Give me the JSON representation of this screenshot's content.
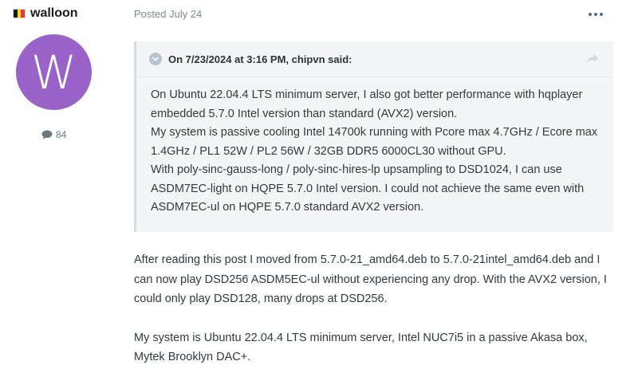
{
  "author": {
    "name": "walloon",
    "avatar_letter": "W",
    "avatar_color": "#9a63c9",
    "post_count": "84",
    "flag_colors": [
      "#1a1a1a",
      "#fdda24",
      "#ef3340"
    ]
  },
  "post": {
    "posted_label": "Posted July 24",
    "quote": {
      "header": "On 7/23/2024 at 3:16 PM, chipvn said:",
      "paragraphs": [
        "On Ubuntu 22.04.4 LTS minimum server, I also got better performance with hqplayer embedded 5.7.0 Intel version than standard (AVX2) version.",
        "My system is passive cooling Intel 14700k running with Pcore max 4.7GHz / Ecore max 1.4GHz / PL1 52W / PL2 56W / 32GB DDR5 6000CL30 without GPU.",
        "With poly-sinc-gauss-long / poly-sinc-hires-lp upsampling to DSD1024, I can use ASDM7EC-light on HQPE 5.7.0 Intel version. I could not achieve the same even with ASDM7EC-ul on HQPE 5.7.0 standard AVX2 version."
      ]
    },
    "body": [
      "After reading this post I moved from 5.7.0-21_amd64.deb to 5.7.0-21intel_amd64.deb and I can now play DSD256 ASDM5EC-ul without experiencing any drop. With the AVX2 version, I could only play DSD128, many drops at DSD256.",
      "My system is Ubuntu 22.04.4 LTS minimum server, Intel NUC7i5 in a passive Akasa box, Mytek Brooklyn DAC+."
    ]
  },
  "icons": {
    "flag": "belgium-flag-icon",
    "comment": "comment-icon",
    "more": "more-options-icon",
    "toggle": "chevron-down-icon",
    "share": "share-arrow-icon"
  }
}
